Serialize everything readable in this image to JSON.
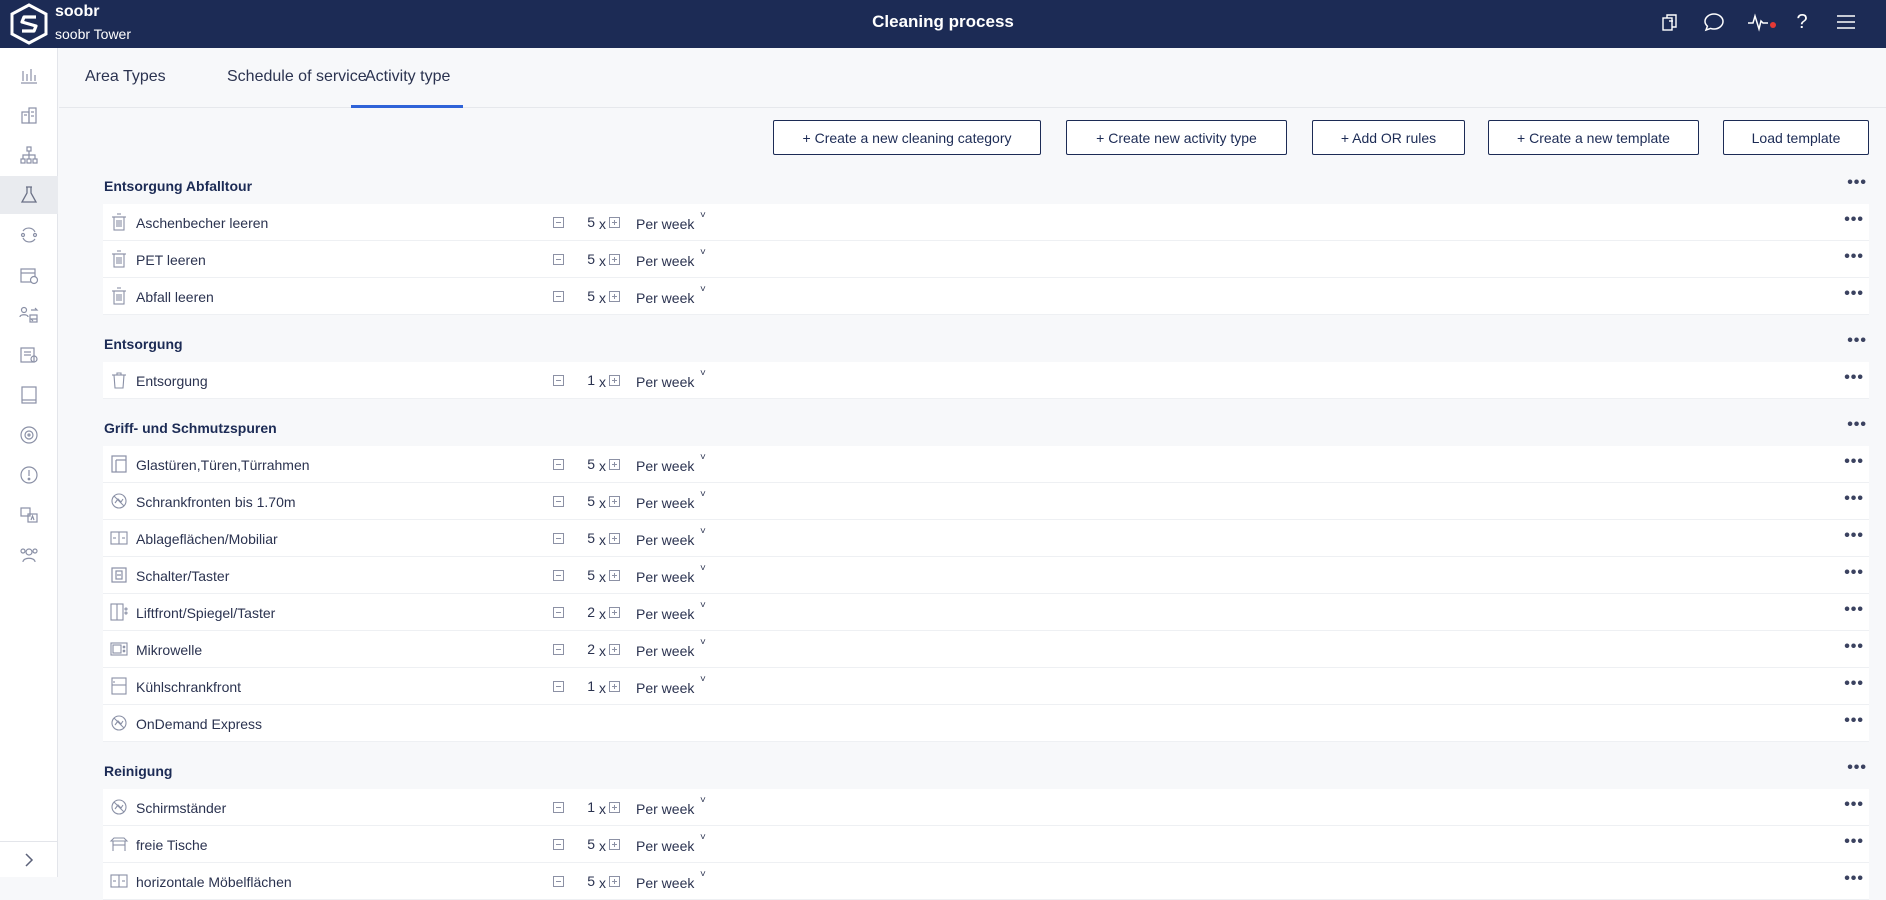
{
  "header": {
    "brand": "soobr",
    "site": "soobr Tower",
    "title": "Cleaning process",
    "icons": [
      "copy-icon",
      "chat-icon",
      "pulse-icon",
      "help-icon",
      "menu-icon"
    ],
    "help_glyph": "?"
  },
  "sidebar": {
    "icons": [
      "chart-icon",
      "buildings-icon",
      "hierarchy-icon",
      "flask-icon",
      "cycle-icon",
      "calendar-icon",
      "swap-user-icon",
      "report-icon",
      "tablet-icon",
      "target-icon",
      "alert-icon",
      "translate-icon",
      "team-icon"
    ],
    "active_index": 3
  },
  "tabs": [
    {
      "label": "Area Types",
      "active": false
    },
    {
      "label": "Schedule of service",
      "active": false
    },
    {
      "label": "Activity type",
      "active": true
    }
  ],
  "actions": {
    "new_category": "+ Create a new cleaning category",
    "new_activity": "+ Create new activity type",
    "or_rules": "+ Add OR rules",
    "new_template": "+ Create a new template",
    "load_template": "Load template"
  },
  "more_glyph": "•••",
  "times_glyph": "x",
  "chevron_glyph": "˅",
  "categories": [
    {
      "title": "Entsorgung Abfalltour",
      "items": [
        {
          "name": "Aschenbecher leeren",
          "icon": "bin-icon",
          "count": "5",
          "period": "Per week"
        },
        {
          "name": "PET leeren",
          "icon": "bin-icon",
          "count": "5",
          "period": "Per week"
        },
        {
          "name": "Abfall leeren",
          "icon": "bin-icon",
          "count": "5",
          "period": "Per week"
        }
      ]
    },
    {
      "title": "Entsorgung",
      "items": [
        {
          "name": "Entsorgung",
          "icon": "trash-icon",
          "count": "1",
          "period": "Per week"
        }
      ]
    },
    {
      "title": "Griff- und Schmutzspuren",
      "items": [
        {
          "name": "Glastüren,Türen,Türrahmen",
          "icon": "door-icon",
          "count": "5",
          "period": "Per week"
        },
        {
          "name": "Schrankfronten bis 1.70m",
          "icon": "hand-icon",
          "count": "5",
          "period": "Per week"
        },
        {
          "name": "Ablageflächen/Mobiliar",
          "icon": "shelf-icon",
          "count": "5",
          "period": "Per week"
        },
        {
          "name": "Schalter/Taster",
          "icon": "switch-icon",
          "count": "5",
          "period": "Per week"
        },
        {
          "name": "Liftfront/Spiegel/Taster",
          "icon": "lift-icon",
          "count": "2",
          "period": "Per week"
        },
        {
          "name": "Mikrowelle",
          "icon": "microwave-icon",
          "count": "2",
          "period": "Per week"
        },
        {
          "name": "Kühlschrankfront",
          "icon": "fridge-icon",
          "count": "1",
          "period": "Per week"
        },
        {
          "name": "OnDemand Express",
          "icon": "hand-icon",
          "count": "",
          "period": ""
        }
      ]
    },
    {
      "title": "Reinigung",
      "items": [
        {
          "name": "Schirmständer",
          "icon": "hand-icon",
          "count": "1",
          "period": "Per week"
        },
        {
          "name": "freie Tische",
          "icon": "table-icon",
          "count": "5",
          "period": "Per week"
        },
        {
          "name": "horizontale Möbelflächen",
          "icon": "shelf-icon",
          "count": "5",
          "period": "Per week"
        }
      ]
    }
  ]
}
